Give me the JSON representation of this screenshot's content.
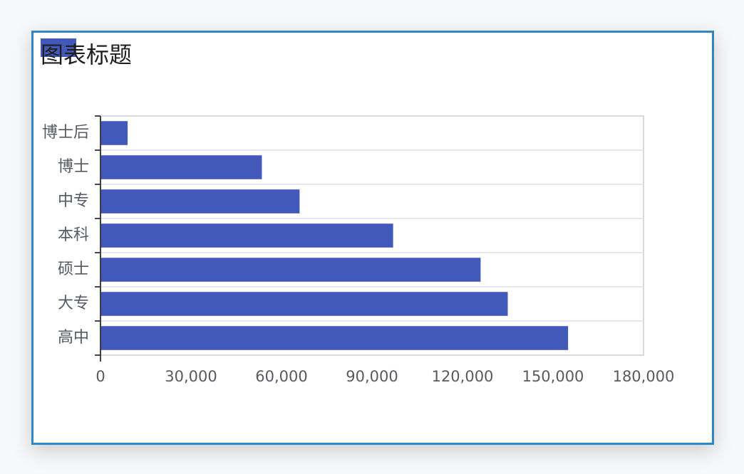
{
  "chart_data": {
    "type": "bar",
    "orientation": "horizontal",
    "title": "图表标题",
    "xlabel": "",
    "ylabel": "",
    "categories": [
      "高中",
      "大专",
      "硕士",
      "本科",
      "中专",
      "博士",
      "博士后"
    ],
    "values": [
      155000,
      135000,
      126000,
      97000,
      66000,
      53500,
      9000
    ],
    "xlim": [
      0,
      180000
    ],
    "xticks": [
      "0",
      "30,000",
      "60,000",
      "90,000",
      "120,000",
      "150,000",
      "180,000"
    ],
    "grid": true,
    "legend": "top-left",
    "bar_color": "#4359b9",
    "frame_color": "#2f87c6"
  }
}
